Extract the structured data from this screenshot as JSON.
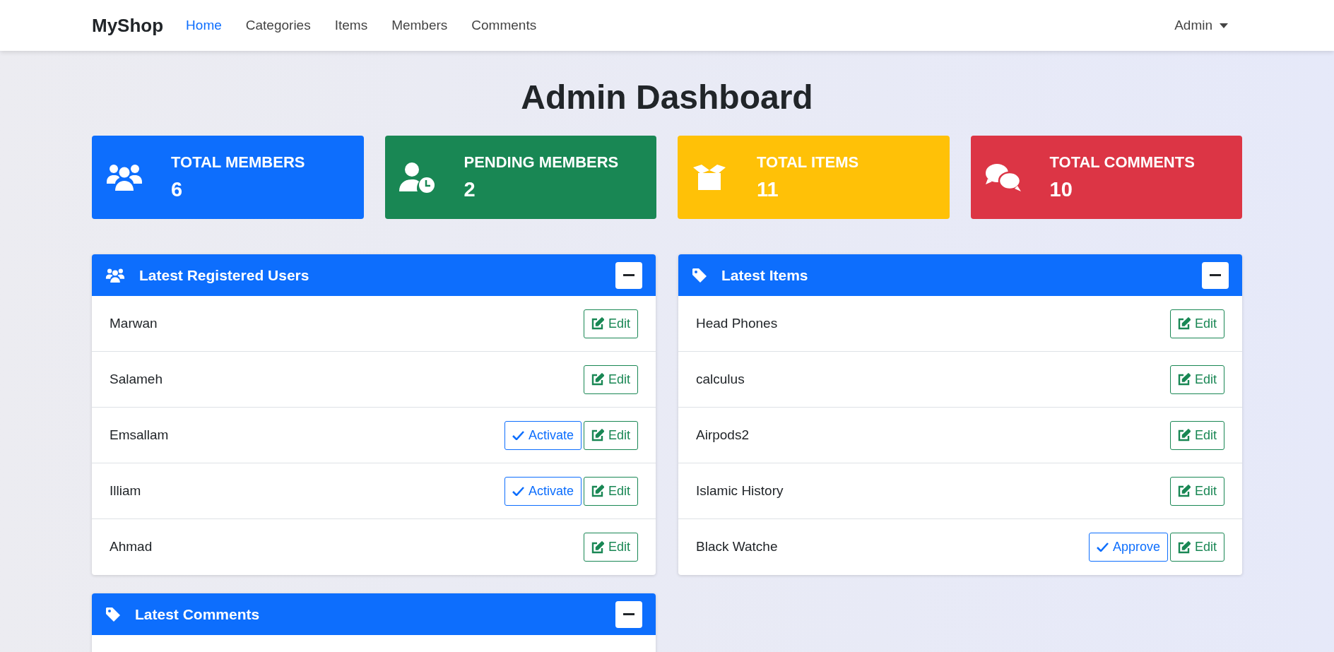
{
  "navbar": {
    "brand": "MyShop",
    "links": [
      {
        "label": "Home",
        "selected": true
      },
      {
        "label": "Categories",
        "selected": false
      },
      {
        "label": "Items",
        "selected": false
      },
      {
        "label": "Members",
        "selected": false
      },
      {
        "label": "Comments",
        "selected": false
      }
    ],
    "user_menu": "Admin"
  },
  "title": "Admin Dashboard",
  "stats": [
    {
      "kind": "members",
      "label": "TOTAL MEMBERS",
      "value": "6",
      "color": "#0d6efd"
    },
    {
      "kind": "pending",
      "label": "PENDING MEMBERS",
      "value": "2",
      "color": "#198754"
    },
    {
      "kind": "items",
      "label": "TOTAL ITEMS",
      "value": "11",
      "color": "#ffc107"
    },
    {
      "kind": "comments",
      "label": "TOTAL COMMENTS",
      "value": "10",
      "color": "#dc3545"
    }
  ],
  "panels": [
    {
      "kind": "users",
      "title": "Latest Registered Users",
      "rows": [
        {
          "name": "Marwan",
          "buttons": [
            {
              "kind": "edit",
              "label": "Edit"
            }
          ]
        },
        {
          "name": "Salameh",
          "buttons": [
            {
              "kind": "edit",
              "label": "Edit"
            }
          ]
        },
        {
          "name": "Emsallam",
          "buttons": [
            {
              "kind": "confirm",
              "label": "Activate"
            },
            {
              "kind": "edit",
              "label": "Edit"
            }
          ]
        },
        {
          "name": "Illiam",
          "buttons": [
            {
              "kind": "confirm",
              "label": "Activate"
            },
            {
              "kind": "edit",
              "label": "Edit"
            }
          ]
        },
        {
          "name": "Ahmad",
          "buttons": [
            {
              "kind": "edit",
              "label": "Edit"
            }
          ]
        }
      ]
    },
    {
      "kind": "tag",
      "title": "Latest Items",
      "rows": [
        {
          "name": "Head Phones",
          "buttons": [
            {
              "kind": "edit",
              "label": "Edit"
            }
          ]
        },
        {
          "name": "calculus",
          "buttons": [
            {
              "kind": "edit",
              "label": "Edit"
            }
          ]
        },
        {
          "name": "Airpods2",
          "buttons": [
            {
              "kind": "edit",
              "label": "Edit"
            }
          ]
        },
        {
          "name": "Islamic History",
          "buttons": [
            {
              "kind": "edit",
              "label": "Edit"
            }
          ]
        },
        {
          "name": "Black Watche",
          "buttons": [
            {
              "kind": "confirm",
              "label": "Approve"
            },
            {
              "kind": "edit",
              "label": "Edit"
            }
          ]
        }
      ]
    },
    {
      "kind": "tag",
      "title": "Latest Comments"
    }
  ]
}
